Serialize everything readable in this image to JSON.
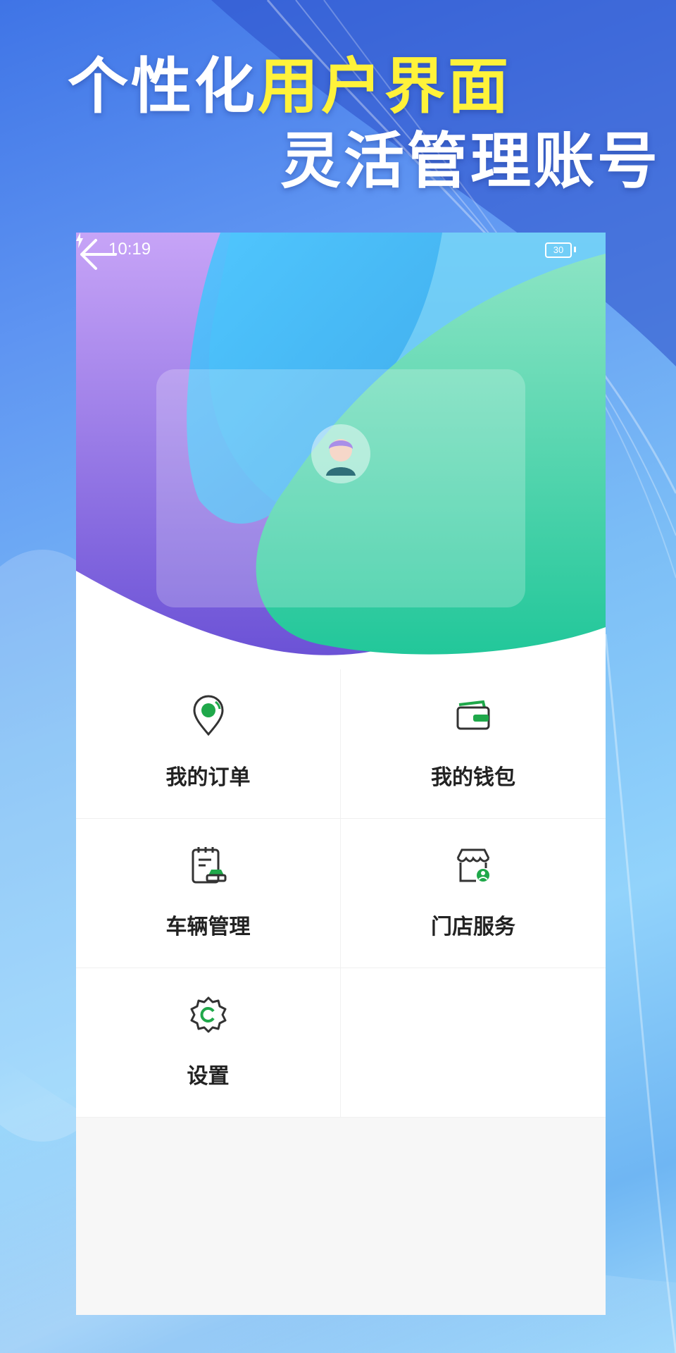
{
  "promo": {
    "line1_plain": "个性化",
    "line1_accent": "用户界面",
    "line2": "灵活管理账号"
  },
  "status_bar": {
    "time": "10:19",
    "battery": "30"
  },
  "menu": {
    "items": [
      {
        "label": "我的订单",
        "icon": "location-pin-icon"
      },
      {
        "label": "我的钱包",
        "icon": "wallet-icon"
      },
      {
        "label": "车辆管理",
        "icon": "vehicle-clipboard-icon"
      },
      {
        "label": "门店服务",
        "icon": "store-icon"
      },
      {
        "label": "设置",
        "icon": "gear-icon"
      }
    ]
  },
  "colors": {
    "accent_yellow": "#fff23a",
    "purple": "#7a5bd9",
    "teal": "#2fc9a0",
    "sky": "#3fb9f2",
    "icon_green": "#1fa84a",
    "label_dark": "#222222"
  }
}
